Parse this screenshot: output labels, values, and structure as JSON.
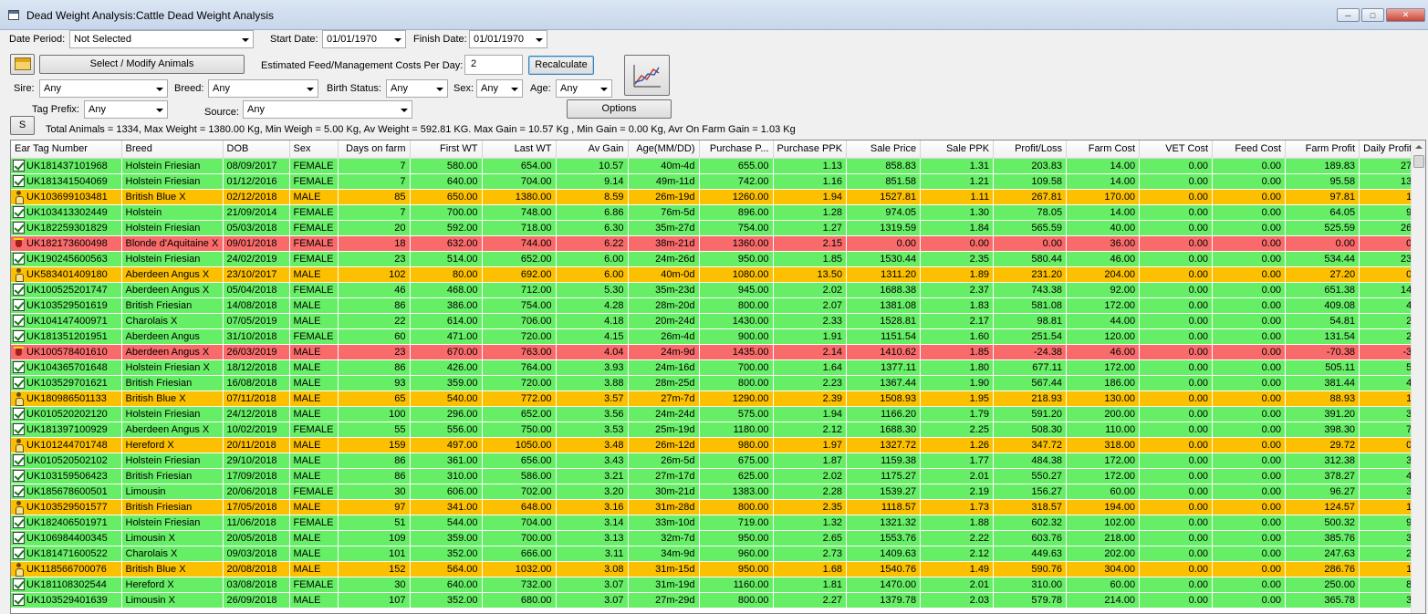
{
  "window": {
    "title": "Dead Weight Analysis:Cattle Dead Weight Analysis"
  },
  "filters": {
    "date_period_label": "Date Period:",
    "date_period_value": "Not Selected",
    "start_date_label": "Start Date:",
    "start_date_value": "01/01/1970",
    "finish_date_label": "Finish Date:",
    "finish_date_value": "01/01/1970",
    "select_animals_label": "Select / Modify Animals",
    "feed_cost_label": "Estimated Feed/Management Costs Per Day:",
    "feed_cost_value": "2",
    "recalculate_label": "Recalculate",
    "sire_label": "Sire:",
    "sire_value": "Any",
    "breed_label": "Breed:",
    "breed_value": "Any",
    "birth_status_label": "Birth Status:",
    "birth_status_value": "Any",
    "sex_label": "Sex:",
    "sex_value": "Any",
    "age_label": "Age:",
    "age_value": "Any",
    "tag_prefix_label": "Tag Prefix:",
    "tag_prefix_value": "Any",
    "source_label": "Source:",
    "source_value": "Any",
    "options_label": "Options",
    "s_button_label": "S"
  },
  "summary": "Total Animals = 1334, Max Weight = 1380.00 Kg, Min Weigh = 5.00 Kg, Av Weight = 592.81 KG. Max Gain = 10.57 Kg , Min Gain = 0.00 Kg, Avr On Farm Gain = 1.03 Kg",
  "table": {
    "columns": [
      "Ear Tag Number",
      "Breed",
      "DOB",
      "Sex",
      "Days on farm",
      "First WT",
      "Last WT",
      "Av Gain",
      "Age(MM/DD)",
      "Purchase P...",
      "Purchase PPK",
      "Sale Price",
      "Sale PPK",
      "Profit/Loss",
      "Farm Cost",
      "VET Cost",
      "Feed Cost",
      "Farm Profit",
      "Daily Profit"
    ],
    "rows": [
      {
        "status": "green",
        "icon": "checkbox-icon",
        "cells": [
          "UK181437101968",
          "Holstein Friesian",
          "08/09/2017",
          "FEMALE",
          "7",
          "580.00",
          "654.00",
          "10.57",
          "40m-4d",
          "655.00",
          "1.13",
          "858.83",
          "1.31",
          "203.83",
          "14.00",
          "0.00",
          "0.00",
          "189.83",
          "27"
        ]
      },
      {
        "status": "green",
        "icon": "checkbox-icon",
        "cells": [
          "UK181341504069",
          "Holstein Friesian",
          "01/12/2016",
          "FEMALE",
          "7",
          "640.00",
          "704.00",
          "9.14",
          "49m-11d",
          "742.00",
          "1.16",
          "851.58",
          "1.21",
          "109.58",
          "14.00",
          "0.00",
          "0.00",
          "95.58",
          "13"
        ]
      },
      {
        "status": "orange",
        "icon": "person-icon",
        "cells": [
          "UK103699103481",
          "British Blue X",
          "02/12/2018",
          "MALE",
          "85",
          "650.00",
          "1380.00",
          "8.59",
          "26m-19d",
          "1260.00",
          "1.94",
          "1527.81",
          "1.11",
          "267.81",
          "170.00",
          "0.00",
          "0.00",
          "97.81",
          "1"
        ]
      },
      {
        "status": "green",
        "icon": "checkbox-icon",
        "cells": [
          "UK103413302449",
          "Holstein",
          "21/09/2014",
          "FEMALE",
          "7",
          "700.00",
          "748.00",
          "6.86",
          "76m-5d",
          "896.00",
          "1.28",
          "974.05",
          "1.30",
          "78.05",
          "14.00",
          "0.00",
          "0.00",
          "64.05",
          "9"
        ]
      },
      {
        "status": "green",
        "icon": "checkbox-icon",
        "cells": [
          "UK182259301829",
          "Holstein Friesian",
          "05/03/2018",
          "FEMALE",
          "20",
          "592.00",
          "718.00",
          "6.30",
          "35m-27d",
          "754.00",
          "1.27",
          "1319.59",
          "1.84",
          "565.59",
          "40.00",
          "0.00",
          "0.00",
          "525.59",
          "26"
        ]
      },
      {
        "status": "red",
        "icon": "bull-icon",
        "cells": [
          "UK182173600498",
          "Blonde d'Aquitaine X",
          "09/01/2018",
          "FEMALE",
          "18",
          "632.00",
          "744.00",
          "6.22",
          "38m-21d",
          "1360.00",
          "2.15",
          "0.00",
          "0.00",
          "0.00",
          "36.00",
          "0.00",
          "0.00",
          "0.00",
          "0"
        ]
      },
      {
        "status": "green",
        "icon": "checkbox-icon",
        "cells": [
          "UK190245600563",
          "Holstein Friesian",
          "24/02/2019",
          "FEMALE",
          "23",
          "514.00",
          "652.00",
          "6.00",
          "24m-26d",
          "950.00",
          "1.85",
          "1530.44",
          "2.35",
          "580.44",
          "46.00",
          "0.00",
          "0.00",
          "534.44",
          "23"
        ]
      },
      {
        "status": "orange",
        "icon": "person-icon",
        "cells": [
          "UK583401409180",
          "Aberdeen Angus X",
          "23/10/2017",
          "MALE",
          "102",
          "80.00",
          "692.00",
          "6.00",
          "40m-0d",
          "1080.00",
          "13.50",
          "1311.20",
          "1.89",
          "231.20",
          "204.00",
          "0.00",
          "0.00",
          "27.20",
          "0"
        ]
      },
      {
        "status": "green",
        "icon": "checkbox-icon",
        "cells": [
          "UK100525201747",
          "Aberdeen Angus X",
          "05/04/2018",
          "FEMALE",
          "46",
          "468.00",
          "712.00",
          "5.30",
          "35m-23d",
          "945.00",
          "2.02",
          "1688.38",
          "2.37",
          "743.38",
          "92.00",
          "0.00",
          "0.00",
          "651.38",
          "14"
        ]
      },
      {
        "status": "green",
        "icon": "checkbox-icon",
        "cells": [
          "UK103529501619",
          "British Friesian",
          "14/08/2018",
          "MALE",
          "86",
          "386.00",
          "754.00",
          "4.28",
          "28m-20d",
          "800.00",
          "2.07",
          "1381.08",
          "1.83",
          "581.08",
          "172.00",
          "0.00",
          "0.00",
          "409.08",
          "4"
        ]
      },
      {
        "status": "green",
        "icon": "checkbox-icon",
        "cells": [
          "UK104147400971",
          "Charolais X",
          "07/05/2019",
          "MALE",
          "22",
          "614.00",
          "706.00",
          "4.18",
          "20m-24d",
          "1430.00",
          "2.33",
          "1528.81",
          "2.17",
          "98.81",
          "44.00",
          "0.00",
          "0.00",
          "54.81",
          "2"
        ]
      },
      {
        "status": "green",
        "icon": "checkbox-icon",
        "cells": [
          "UK181351201951",
          "Aberdeen Angus",
          "31/10/2018",
          "FEMALE",
          "60",
          "471.00",
          "720.00",
          "4.15",
          "26m-4d",
          "900.00",
          "1.91",
          "1151.54",
          "1.60",
          "251.54",
          "120.00",
          "0.00",
          "0.00",
          "131.54",
          "2"
        ]
      },
      {
        "status": "red",
        "icon": "bull-icon",
        "cells": [
          "UK100578401610",
          "Aberdeen Angus X",
          "26/03/2019",
          "MALE",
          "23",
          "670.00",
          "763.00",
          "4.04",
          "24m-9d",
          "1435.00",
          "2.14",
          "1410.62",
          "1.85",
          "-24.38",
          "46.00",
          "0.00",
          "0.00",
          "-70.38",
          "-3"
        ]
      },
      {
        "status": "green",
        "icon": "checkbox-icon",
        "cells": [
          "UK104365701648",
          "Holstein Friesian X",
          "18/12/2018",
          "MALE",
          "86",
          "426.00",
          "764.00",
          "3.93",
          "24m-16d",
          "700.00",
          "1.64",
          "1377.11",
          "1.80",
          "677.11",
          "172.00",
          "0.00",
          "0.00",
          "505.11",
          "5"
        ]
      },
      {
        "status": "green",
        "icon": "checkbox-icon",
        "cells": [
          "UK103529701621",
          "British Friesian",
          "16/08/2018",
          "MALE",
          "93",
          "359.00",
          "720.00",
          "3.88",
          "28m-25d",
          "800.00",
          "2.23",
          "1367.44",
          "1.90",
          "567.44",
          "186.00",
          "0.00",
          "0.00",
          "381.44",
          "4"
        ]
      },
      {
        "status": "orange",
        "icon": "person-icon",
        "cells": [
          "UK180986501133",
          "British Blue X",
          "07/11/2018",
          "MALE",
          "65",
          "540.00",
          "772.00",
          "3.57",
          "27m-7d",
          "1290.00",
          "2.39",
          "1508.93",
          "1.95",
          "218.93",
          "130.00",
          "0.00",
          "0.00",
          "88.93",
          "1"
        ]
      },
      {
        "status": "green",
        "icon": "checkbox-icon",
        "cells": [
          "UK010520202120",
          "Holstein Friesian",
          "24/12/2018",
          "MALE",
          "100",
          "296.00",
          "652.00",
          "3.56",
          "24m-24d",
          "575.00",
          "1.94",
          "1166.20",
          "1.79",
          "591.20",
          "200.00",
          "0.00",
          "0.00",
          "391.20",
          "3"
        ]
      },
      {
        "status": "green",
        "icon": "checkbox-icon",
        "cells": [
          "UK181397100929",
          "Aberdeen Angus X",
          "10/02/2019",
          "FEMALE",
          "55",
          "556.00",
          "750.00",
          "3.53",
          "25m-19d",
          "1180.00",
          "2.12",
          "1688.30",
          "2.25",
          "508.30",
          "110.00",
          "0.00",
          "0.00",
          "398.30",
          "7"
        ]
      },
      {
        "status": "orange",
        "icon": "person-icon",
        "cells": [
          "UK101244701748",
          "Hereford X",
          "20/11/2018",
          "MALE",
          "159",
          "497.00",
          "1050.00",
          "3.48",
          "26m-12d",
          "980.00",
          "1.97",
          "1327.72",
          "1.26",
          "347.72",
          "318.00",
          "0.00",
          "0.00",
          "29.72",
          "0"
        ]
      },
      {
        "status": "green",
        "icon": "checkbox-icon",
        "cells": [
          "UK010520502102",
          "Holstein Friesian",
          "29/10/2018",
          "MALE",
          "86",
          "361.00",
          "656.00",
          "3.43",
          "26m-5d",
          "675.00",
          "1.87",
          "1159.38",
          "1.77",
          "484.38",
          "172.00",
          "0.00",
          "0.00",
          "312.38",
          "3"
        ]
      },
      {
        "status": "green",
        "icon": "checkbox-icon",
        "cells": [
          "UK103159506423",
          "British Friesian",
          "17/09/2018",
          "MALE",
          "86",
          "310.00",
          "586.00",
          "3.21",
          "27m-17d",
          "625.00",
          "2.02",
          "1175.27",
          "2.01",
          "550.27",
          "172.00",
          "0.00",
          "0.00",
          "378.27",
          "4"
        ]
      },
      {
        "status": "green",
        "icon": "checkbox-icon",
        "cells": [
          "UK185678600501",
          "Limousin",
          "20/06/2018",
          "FEMALE",
          "30",
          "606.00",
          "702.00",
          "3.20",
          "30m-21d",
          "1383.00",
          "2.28",
          "1539.27",
          "2.19",
          "156.27",
          "60.00",
          "0.00",
          "0.00",
          "96.27",
          "3"
        ]
      },
      {
        "status": "orange",
        "icon": "person-icon",
        "cells": [
          "UK103529501577",
          "British Friesian",
          "17/05/2018",
          "MALE",
          "97",
          "341.00",
          "648.00",
          "3.16",
          "31m-28d",
          "800.00",
          "2.35",
          "1118.57",
          "1.73",
          "318.57",
          "194.00",
          "0.00",
          "0.00",
          "124.57",
          "1"
        ]
      },
      {
        "status": "green",
        "icon": "checkbox-icon",
        "cells": [
          "UK182406501971",
          "Holstein Friesian",
          "11/06/2018",
          "FEMALE",
          "51",
          "544.00",
          "704.00",
          "3.14",
          "33m-10d",
          "719.00",
          "1.32",
          "1321.32",
          "1.88",
          "602.32",
          "102.00",
          "0.00",
          "0.00",
          "500.32",
          "9"
        ]
      },
      {
        "status": "green",
        "icon": "checkbox-icon",
        "cells": [
          "UK106984400345",
          "Limousin X",
          "20/05/2018",
          "MALE",
          "109",
          "359.00",
          "700.00",
          "3.13",
          "32m-7d",
          "950.00",
          "2.65",
          "1553.76",
          "2.22",
          "603.76",
          "218.00",
          "0.00",
          "0.00",
          "385.76",
          "3"
        ]
      },
      {
        "status": "green",
        "icon": "checkbox-icon",
        "cells": [
          "UK181471600522",
          "Charolais X",
          "09/03/2018",
          "MALE",
          "101",
          "352.00",
          "666.00",
          "3.11",
          "34m-9d",
          "960.00",
          "2.73",
          "1409.63",
          "2.12",
          "449.63",
          "202.00",
          "0.00",
          "0.00",
          "247.63",
          "2"
        ]
      },
      {
        "status": "orange",
        "icon": "person-icon",
        "cells": [
          "UK118566700076",
          "British Blue X",
          "20/08/2018",
          "MALE",
          "152",
          "564.00",
          "1032.00",
          "3.08",
          "31m-15d",
          "950.00",
          "1.68",
          "1540.76",
          "1.49",
          "590.76",
          "304.00",
          "0.00",
          "0.00",
          "286.76",
          "1"
        ]
      },
      {
        "status": "green",
        "icon": "checkbox-icon",
        "cells": [
          "UK181108302544",
          "Hereford X",
          "03/08/2018",
          "FEMALE",
          "30",
          "640.00",
          "732.00",
          "3.07",
          "31m-19d",
          "1160.00",
          "1.81",
          "1470.00",
          "2.01",
          "310.00",
          "60.00",
          "0.00",
          "0.00",
          "250.00",
          "8"
        ]
      },
      {
        "status": "green",
        "icon": "checkbox-icon",
        "cells": [
          "UK103529401639",
          "Limousin X",
          "26/09/2018",
          "MALE",
          "107",
          "352.00",
          "680.00",
          "3.07",
          "27m-29d",
          "800.00",
          "2.27",
          "1379.78",
          "2.03",
          "579.78",
          "214.00",
          "0.00",
          "0.00",
          "365.78",
          "3"
        ]
      }
    ]
  },
  "colors": {
    "row_green": "#66ee66",
    "row_orange": "#fdc000",
    "row_red": "#f96b6b"
  }
}
